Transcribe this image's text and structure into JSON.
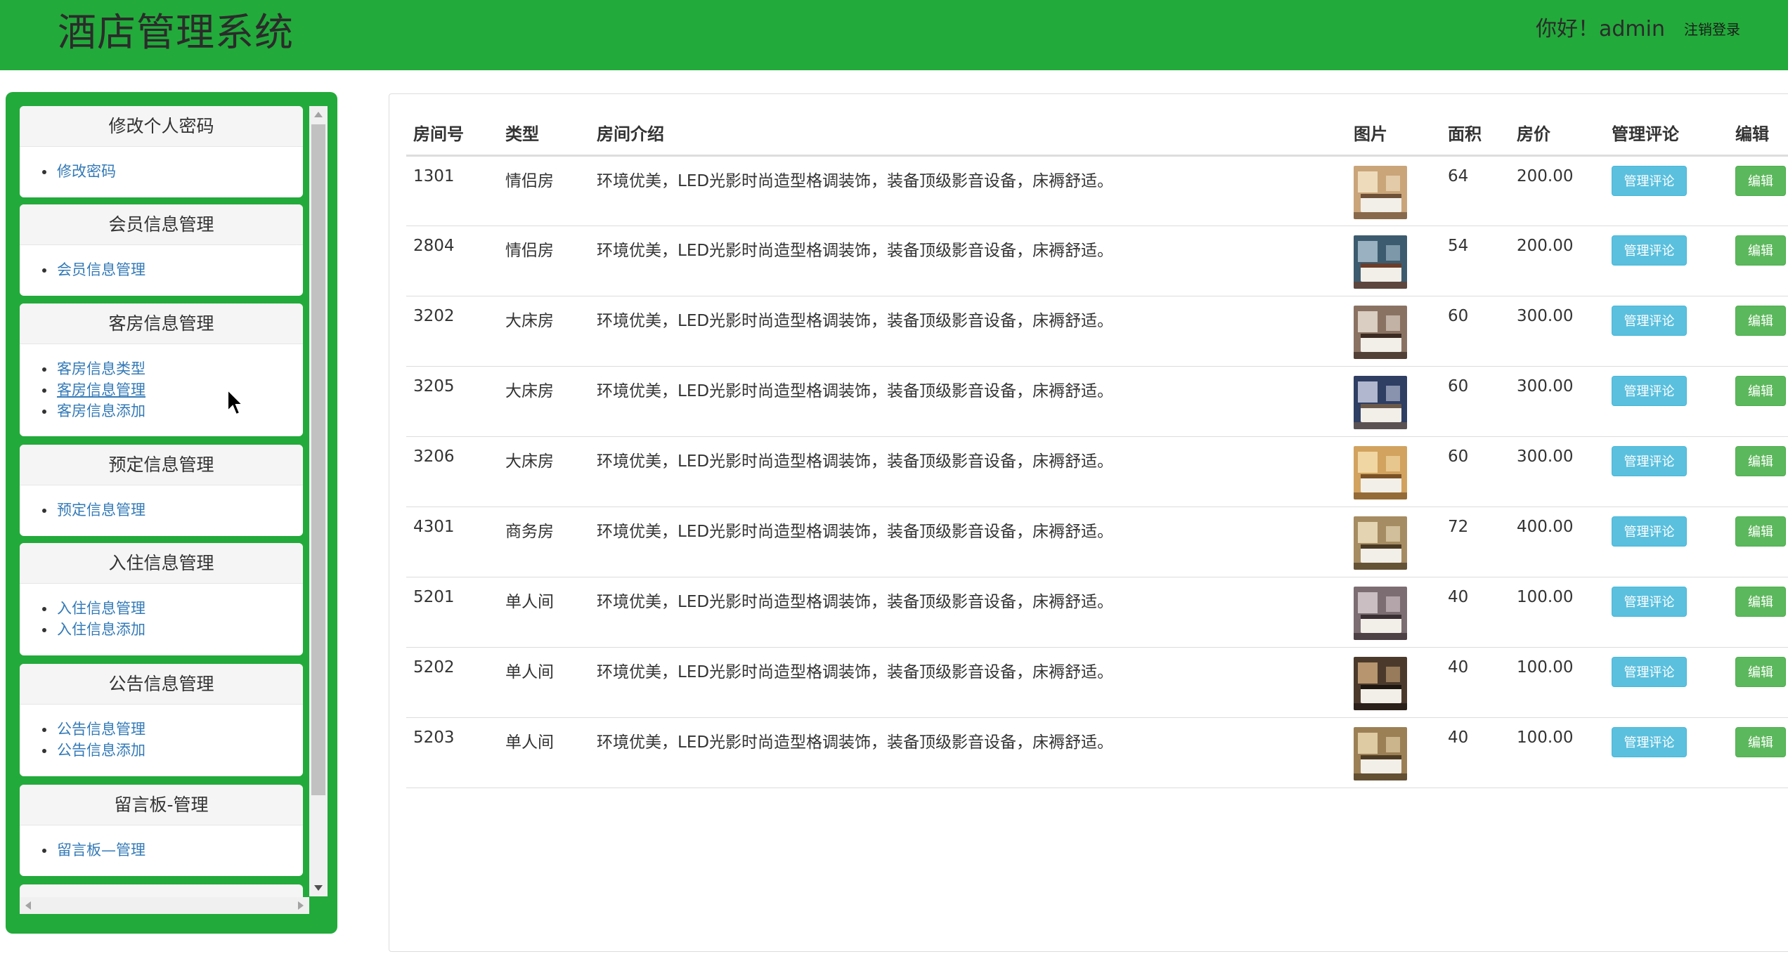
{
  "header": {
    "title": "酒店管理系统",
    "greeting": "你好！admin",
    "logout": "注销登录",
    "bg_color": "#22aa3a"
  },
  "sidebar": {
    "panels": [
      {
        "title": "修改个人密码",
        "links": [
          "修改密码"
        ]
      },
      {
        "title": "会员信息管理",
        "links": [
          "会员信息管理"
        ]
      },
      {
        "title": "客房信息管理",
        "links": [
          "客房信息类型",
          "客房信息管理",
          "客房信息添加"
        ]
      },
      {
        "title": "预定信息管理",
        "links": [
          "预定信息管理"
        ]
      },
      {
        "title": "入住信息管理",
        "links": [
          "入住信息管理",
          "入住信息添加"
        ]
      },
      {
        "title": "公告信息管理",
        "links": [
          "公告信息管理",
          "公告信息添加"
        ]
      },
      {
        "title": "留言板-管理",
        "links": [
          "留言板—管理"
        ]
      }
    ],
    "link_color": "#337ab7"
  },
  "table": {
    "headers": [
      "房间号",
      "类型",
      "房间介绍",
      "图片",
      "面积",
      "房价",
      "管理评论",
      "编辑"
    ],
    "button_comment": "管理评论",
    "button_edit": "编辑",
    "rows": [
      {
        "room": "1301",
        "type": "情侣房",
        "desc": "环境优美，LED光影时尚造型格调装饰，装备顶级影音设备，床褥舒适。",
        "area": "64",
        "price": "200.00"
      },
      {
        "room": "2804",
        "type": "情侣房",
        "desc": "环境优美，LED光影时尚造型格调装饰，装备顶级影音设备，床褥舒适。",
        "area": "54",
        "price": "200.00"
      },
      {
        "room": "3202",
        "type": "大床房",
        "desc": "环境优美，LED光影时尚造型格调装饰，装备顶级影音设备，床褥舒适。",
        "area": "60",
        "price": "300.00"
      },
      {
        "room": "3205",
        "type": "大床房",
        "desc": "环境优美，LED光影时尚造型格调装饰，装备顶级影音设备，床褥舒适。",
        "area": "60",
        "price": "300.00"
      },
      {
        "room": "3206",
        "type": "大床房",
        "desc": "环境优美，LED光影时尚造型格调装饰，装备顶级影音设备，床褥舒适。",
        "area": "60",
        "price": "300.00"
      },
      {
        "room": "4301",
        "type": "商务房",
        "desc": "环境优美，LED光影时尚造型格调装饰，装备顶级影音设备，床褥舒适。",
        "area": "72",
        "price": "400.00"
      },
      {
        "room": "5201",
        "type": "单人间",
        "desc": "环境优美，LED光影时尚造型格调装饰，装备顶级影音设备，床褥舒适。",
        "area": "40",
        "price": "100.00"
      },
      {
        "room": "5202",
        "type": "单人间",
        "desc": "环境优美，LED光影时尚造型格调装饰，装备顶级影音设备，床褥舒适。",
        "area": "40",
        "price": "100.00"
      },
      {
        "room": "5203",
        "type": "单人间",
        "desc": "环境优美，LED光影时尚造型格调装饰，装备顶级影音设备，床褥舒适。",
        "area": "40",
        "price": "100.00"
      }
    ],
    "comment_color": "#5bc0de",
    "edit_color": "#5cb85c"
  }
}
